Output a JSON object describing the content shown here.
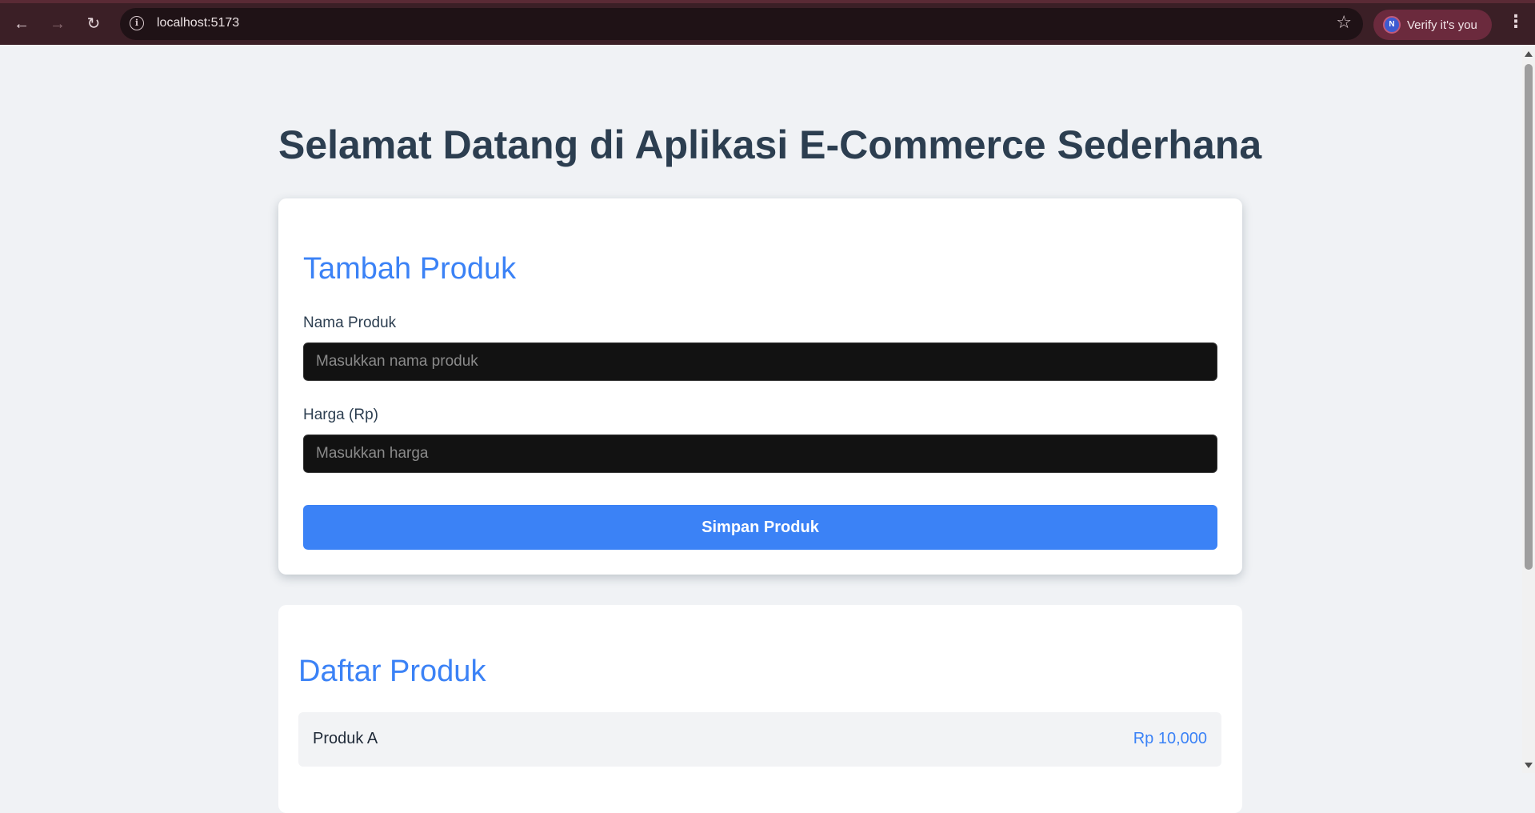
{
  "browser": {
    "url": "localhost:5173",
    "verify_label": "Verify it's you",
    "avatar_initial": "N"
  },
  "page": {
    "title": "Selamat Datang di Aplikasi E-Commerce Sederhana"
  },
  "form": {
    "title": "Tambah Produk",
    "name_label": "Nama Produk",
    "name_value": "",
    "name_placeholder": "Masukkan nama produk",
    "price_label": "Harga (Rp)",
    "price_value": "",
    "price_placeholder": "Masukkan harga",
    "submit_label": "Simpan Produk"
  },
  "list": {
    "title": "Daftar Produk",
    "products": [
      {
        "name": "Produk A",
        "price": "Rp 10,000"
      }
    ]
  },
  "colors": {
    "accent": "#3b82f6",
    "heading": "#2c3e50",
    "page_bg": "#f0f2f5",
    "input_bg": "#121212"
  }
}
